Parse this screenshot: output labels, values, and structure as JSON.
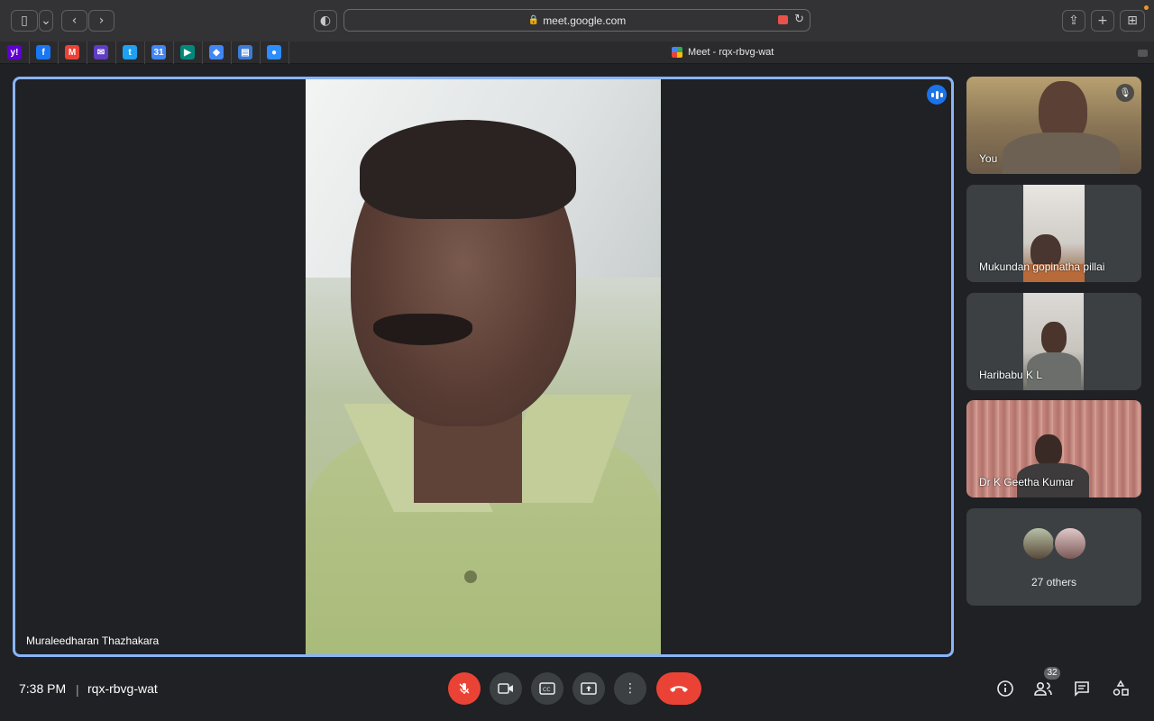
{
  "browser": {
    "url": "meet.google.com",
    "tab_title": "Meet - rqx-rbvg-wat",
    "bookmarks": [
      {
        "icon": "yahoo-icon",
        "label": "y!",
        "color": "#6001d2"
      },
      {
        "icon": "facebook-icon",
        "label": "f",
        "color": "#1877f2"
      },
      {
        "icon": "gmail-icon",
        "label": "M",
        "color": "#ea4335"
      },
      {
        "icon": "mail-icon",
        "label": "✉",
        "color": "#5f3dc4"
      },
      {
        "icon": "twitter-icon",
        "label": "t",
        "color": "#1da1f2"
      },
      {
        "icon": "calendar-icon",
        "label": "31",
        "color": "#4285f4"
      },
      {
        "icon": "meet-icon",
        "label": "▶",
        "color": "#00897b"
      },
      {
        "icon": "maps-icon",
        "label": "◆",
        "color": "#4285f4"
      },
      {
        "icon": "chart-icon",
        "label": "▤",
        "color": "#3d7bd6"
      },
      {
        "icon": "zoom-icon",
        "label": "●",
        "color": "#2d8cff"
      }
    ]
  },
  "main_video": {
    "participant": "Muraleedharan Thazhakara"
  },
  "side_tiles": [
    {
      "name": "You"
    },
    {
      "name": "Mukundan gopinatha pillai"
    },
    {
      "name": "Haribabu K L"
    },
    {
      "name": "Dr K Geetha Kumar"
    }
  ],
  "others": {
    "label": "27 others"
  },
  "bottom_bar": {
    "time": "7:38 PM",
    "separator": "|",
    "meeting_code": "rqx-rbvg-wat",
    "participant_count": "32"
  },
  "colors": {
    "accent": "#8ab4f8",
    "danger": "#ea4335",
    "speaking": "#1a73e8"
  }
}
